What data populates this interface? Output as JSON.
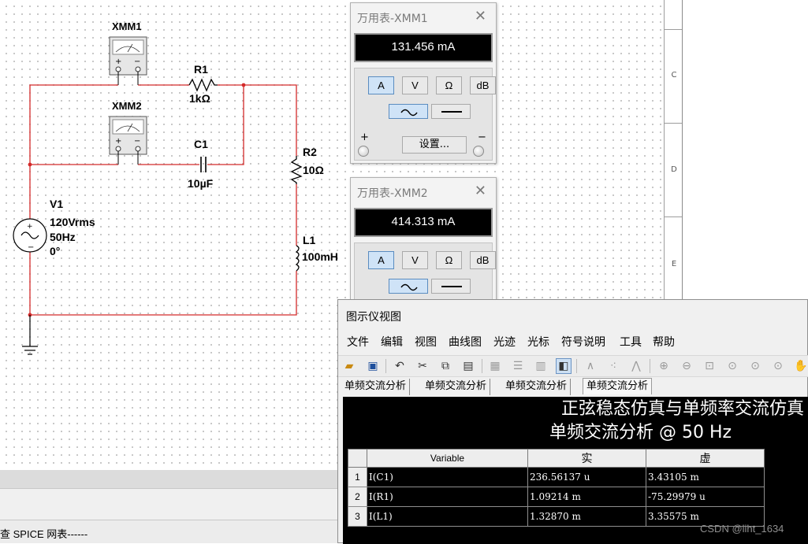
{
  "circuit": {
    "xmm1_label": "XMM1",
    "xmm2_label": "XMM2",
    "r1_name": "R1",
    "r1_value": "1kΩ",
    "c1_name": "C1",
    "c1_value": "10µF",
    "r2_name": "R2",
    "r2_value": "10Ω",
    "l1_name": "L1",
    "l1_value": "100mH",
    "v1_name": "V1",
    "v1_amplitude": "120Vrms",
    "v1_freq": "50Hz",
    "v1_phase": "0°",
    "wire_color": "#d42a2a"
  },
  "sheet_border": {
    "zones": [
      "C",
      "D",
      "E"
    ]
  },
  "multimeter1": {
    "title": "万用表-XMM1",
    "reading": "131.456 mA",
    "modes": [
      "A",
      "V",
      "Ω",
      "dB"
    ],
    "active_mode": "A",
    "settings_label": "设置...",
    "plus": "+",
    "minus": "−"
  },
  "multimeter2": {
    "title": "万用表-XMM2",
    "reading": "414.313 mA",
    "modes": [
      "A",
      "V",
      "Ω",
      "dB"
    ],
    "active_mode": "A"
  },
  "grapher": {
    "title": "图示仪视图",
    "menu": [
      "文件",
      "编辑",
      "视图",
      "曲线图",
      "光迹",
      "光标",
      "符号说明",
      "工具",
      "帮助"
    ],
    "tabs": [
      "单频交流分析",
      "单频交流分析",
      "单频交流分析",
      "单频交流分析"
    ],
    "active_tab": 3,
    "plot_title": "正弦稳态仿真与单频率交流仿真",
    "plot_subtitle": "单频交流分析 @ 50 Hz",
    "table": {
      "headers": [
        "Variable",
        "实",
        "虚"
      ],
      "rows": [
        {
          "index": "1",
          "variable": "I(C1)",
          "real": "236.56137 u",
          "imag": "3.43105 m"
        },
        {
          "index": "2",
          "variable": "I(R1)",
          "real": "1.09214 m",
          "imag": "-75.29979 u"
        },
        {
          "index": "3",
          "variable": "I(L1)",
          "real": "1.32870 m",
          "imag": "3.35575 m"
        }
      ]
    }
  },
  "status": {
    "spice_text": "查 SPICE 网表------"
  },
  "watermark": "CSDN @liht_1634"
}
